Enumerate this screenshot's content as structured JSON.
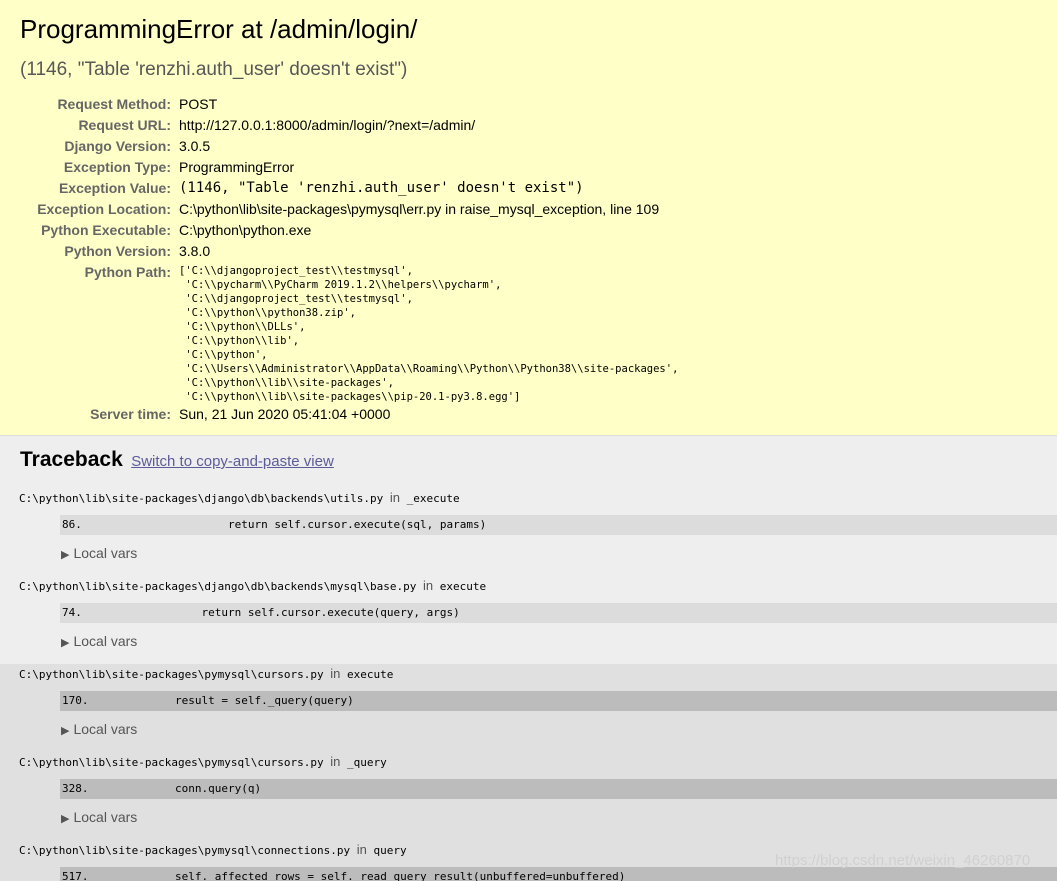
{
  "summary": {
    "title": "ProgrammingError at /admin/login/",
    "subtitle": "(1146, \"Table 'renzhi.auth_user' doesn't exist\")",
    "rows": [
      {
        "label": "Request Method:",
        "value": "POST"
      },
      {
        "label": "Request URL:",
        "value": "http://127.0.0.1:8000/admin/login/?next=/admin/"
      },
      {
        "label": "Django Version:",
        "value": "3.0.5"
      },
      {
        "label": "Exception Type:",
        "value": "ProgrammingError"
      },
      {
        "label": "Exception Value:",
        "value": "(1146, \"Table 'renzhi.auth_user' doesn't exist\")"
      },
      {
        "label": "Exception Location:",
        "value": "C:\\python\\lib\\site-packages\\pymysql\\err.py in raise_mysql_exception, line 109"
      },
      {
        "label": "Python Executable:",
        "value": "C:\\python\\python.exe"
      },
      {
        "label": "Python Version:",
        "value": "3.8.0"
      },
      {
        "label": "Python Path:",
        "value": "['C:\\\\djangoproject_test\\\\testmysql',\n 'C:\\\\pycharm\\\\PyCharm 2019.1.2\\\\helpers\\\\pycharm',\n 'C:\\\\djangoproject_test\\\\testmysql',\n 'C:\\\\python\\\\python38.zip',\n 'C:\\\\python\\\\DLLs',\n 'C:\\\\python\\\\lib',\n 'C:\\\\python',\n 'C:\\\\Users\\\\Administrator\\\\AppData\\\\Roaming\\\\Python\\\\Python38\\\\site-packages',\n 'C:\\\\python\\\\lib\\\\site-packages',\n 'C:\\\\python\\\\lib\\\\site-packages\\\\pip-20.1-py3.8.egg']"
      },
      {
        "label": "Server time:",
        "value": "Sun, 21 Jun 2020 05:41:04 +0000"
      }
    ]
  },
  "traceback": {
    "title": "Traceback",
    "switch_link": "Switch to copy-and-paste view",
    "in_word": "in",
    "local_vars_label": "Local vars",
    "frames": [
      {
        "file": "C:\\python\\lib\\site-packages\\django\\db\\backends\\utils.py",
        "func": "_execute",
        "lineno": "86.",
        "code": "                return self.cursor.execute(sql, params)"
      },
      {
        "file": "C:\\python\\lib\\site-packages\\django\\db\\backends\\mysql\\base.py",
        "func": "execute",
        "lineno": "74.",
        "code": "            return self.cursor.execute(query, args)"
      },
      {
        "file": "C:\\python\\lib\\site-packages\\pymysql\\cursors.py",
        "func": "execute",
        "lineno": "170.",
        "code": "        result = self._query(query)"
      },
      {
        "file": "C:\\python\\lib\\site-packages\\pymysql\\cursors.py",
        "func": "_query",
        "lineno": "328.",
        "code": "        conn.query(q)"
      },
      {
        "file": "C:\\python\\lib\\site-packages\\pymysql\\connections.py",
        "func": "query",
        "lineno": "517.",
        "code": "        self._affected_rows = self._read_query_result(unbuffered=unbuffered)"
      }
    ]
  },
  "watermark": "https://blog.csdn.net/weixin_46260870",
  "colors": {
    "summary_bg": "#ffffc8",
    "page_bg": "#eeeeee",
    "link": "#5b5b99"
  }
}
